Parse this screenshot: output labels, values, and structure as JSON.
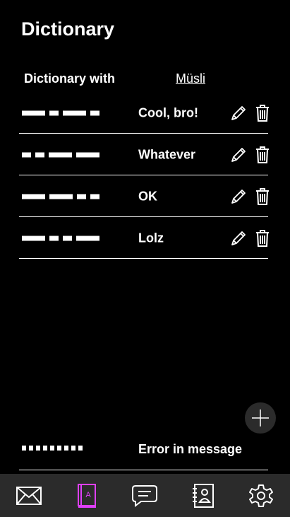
{
  "header": {
    "title": "Dictionary"
  },
  "dictionary_with": {
    "label": "Dictionary with",
    "contact": "Müsli"
  },
  "entries": [
    {
      "pattern": [
        "long",
        "short",
        "long",
        "short"
      ],
      "meaning": "Cool, bro!"
    },
    {
      "pattern": [
        "short",
        "short",
        "long",
        "long"
      ],
      "meaning": "Whatever"
    },
    {
      "pattern": [
        "long",
        "long",
        "short",
        "short"
      ],
      "meaning": "OK"
    },
    {
      "pattern": [
        "long",
        "short",
        "short",
        "long"
      ],
      "meaning": "Lolz"
    }
  ],
  "error_entry": {
    "dots": 9,
    "meaning": "Error in message"
  },
  "icons": {
    "edit": "pencil-icon",
    "delete": "trash-icon",
    "add": "plus-icon",
    "nav": [
      "envelope-icon",
      "dictionary-book-icon",
      "chat-bubble-icon",
      "contacts-book-icon",
      "gear-icon"
    ]
  },
  "colors": {
    "background": "#000000",
    "nav_bar": "#2b2b2b",
    "active_nav": "#e040fb",
    "foreground": "#ffffff"
  },
  "nav_active_index": 1
}
